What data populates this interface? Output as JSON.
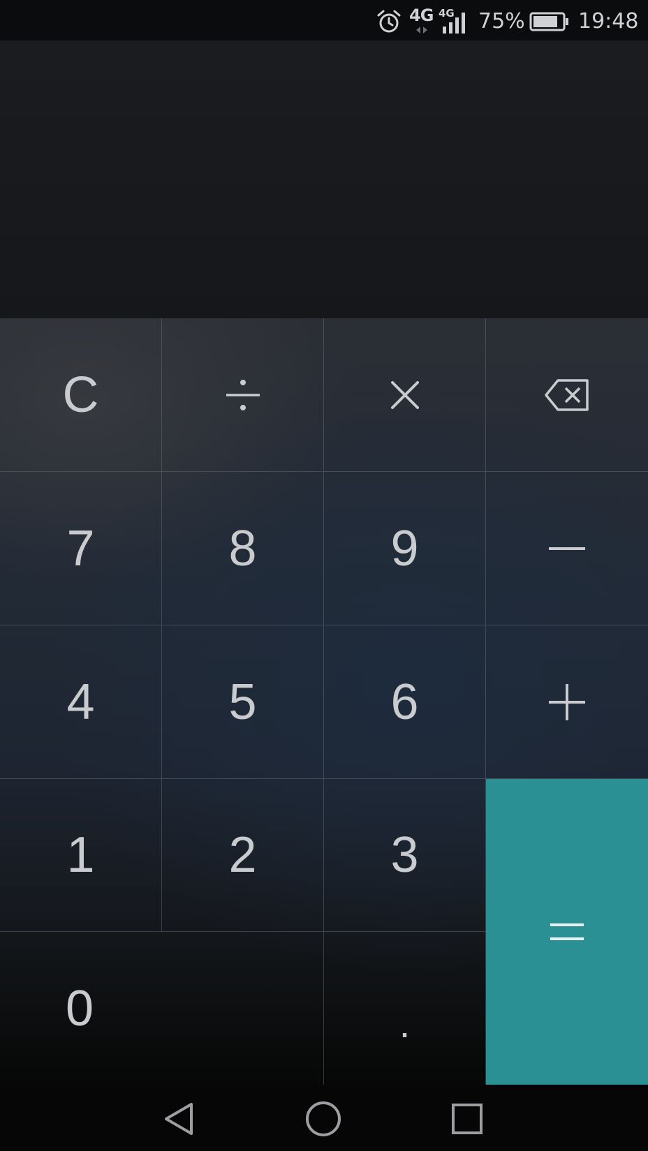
{
  "status_bar": {
    "network_primary": "4G",
    "network_secondary": "4G",
    "battery_percent": "75%",
    "time": "19:48",
    "icons": [
      "alarm-icon",
      "data-arrows-icon",
      "signal-icon",
      "battery-icon"
    ]
  },
  "display": {
    "expression": "",
    "result": ""
  },
  "keypad": {
    "clear": "C",
    "divide": "÷",
    "multiply": "×",
    "digits": {
      "d7": "7",
      "d8": "8",
      "d9": "9",
      "d4": "4",
      "d5": "5",
      "d6": "6",
      "d1": "1",
      "d2": "2",
      "d3": "3",
      "d0": "0"
    },
    "decimal": "."
  },
  "colors": {
    "equals_key": "#2b9094",
    "key_text": "#c9cbce",
    "display_bg": "#1b1c20",
    "nav_bg": "#060606"
  },
  "nav_bar": {
    "icons": [
      "back-icon",
      "home-icon",
      "recent-apps-icon"
    ]
  }
}
